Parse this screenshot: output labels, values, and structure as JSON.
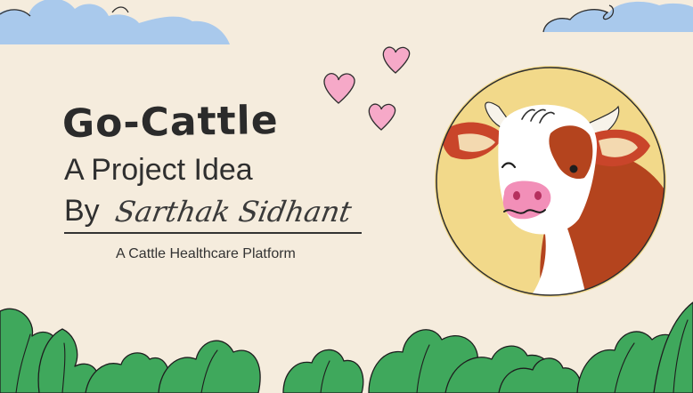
{
  "slide": {
    "title": "Go-Cattle",
    "subtitle_line": "A Project Idea",
    "by_label": "By",
    "author": "Sarthak Sidhant",
    "tagline": "A Cattle Healthcare Platform"
  },
  "colors": {
    "background": "#f5ecdd",
    "cloud": "#a9c9ec",
    "heart": "#f6a9c8",
    "circle": "#f2d98a",
    "leaf": "#3fa85c",
    "cow_brown": "#b4441e",
    "cow_nose": "#f28fb8"
  },
  "icons": [
    "cloud-icon",
    "heart-icon",
    "cow-icon",
    "leaf-icon"
  ]
}
